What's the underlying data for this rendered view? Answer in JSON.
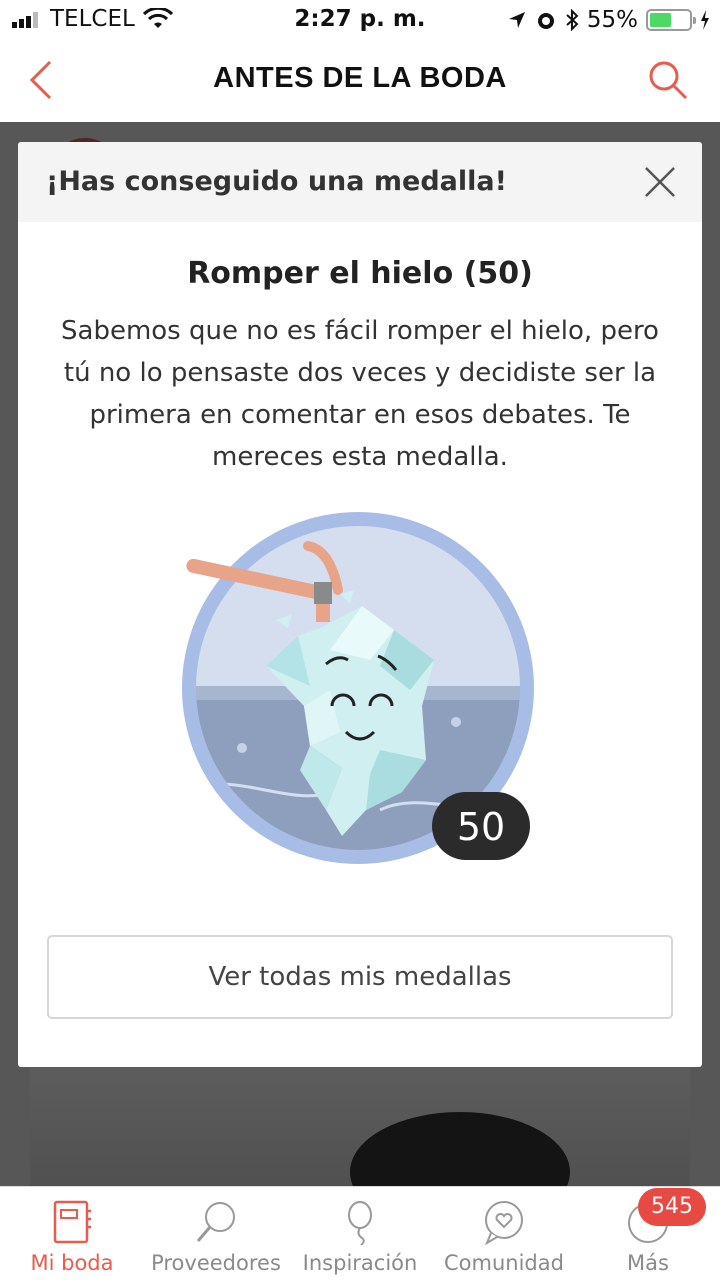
{
  "status_bar": {
    "carrier": "TELCEL",
    "time": "2:27 p. m.",
    "battery": "55%",
    "battery_level": 0.55
  },
  "nav": {
    "title": "ANTES DE LA BODA",
    "back_icon": "chevron-left-icon",
    "search_icon": "search-icon"
  },
  "modal": {
    "header": "¡Has conseguido una medalla!",
    "close_icon": "close-icon",
    "medal_title": "Romper el hielo (50)",
    "description": "Sabemos que no es fácil romper el hielo, pero tú no lo pensaste dos veces y decidiste ser la primera en comentar en esos debates. Te mereces esta medalla.",
    "medal_points": "50",
    "button_label": "Ver todas mis medallas"
  },
  "tabbar": {
    "items": [
      {
        "label": "Mi boda",
        "icon": "notebook-icon",
        "active": true
      },
      {
        "label": "Proveedores",
        "icon": "magnifier-icon",
        "active": false
      },
      {
        "label": "Inspiración",
        "icon": "balloon-icon",
        "active": false
      },
      {
        "label": "Comunidad",
        "icon": "chat-heart-icon",
        "active": false
      },
      {
        "label": "Más",
        "icon": "more-icon",
        "active": false
      }
    ],
    "badge": "545"
  },
  "colors": {
    "accent": "#e85b4f",
    "badge": "#e74a43"
  }
}
